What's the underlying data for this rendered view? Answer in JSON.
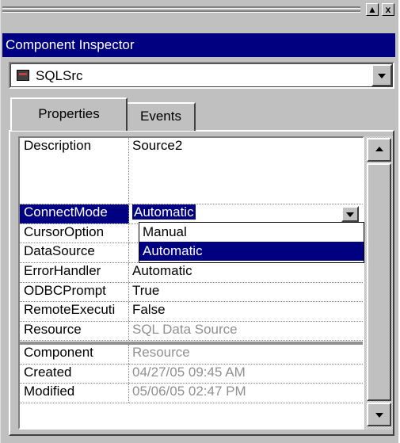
{
  "window": {
    "title": "Component Inspector",
    "restore_glyph": "▲",
    "close_glyph": "x"
  },
  "component_selector": {
    "value": "SQLSrc",
    "icon": "sql-source-icon"
  },
  "tabs": [
    {
      "label": "Properties",
      "active": true
    },
    {
      "label": "Events",
      "active": false
    }
  ],
  "properties": [
    {
      "name": "Description",
      "value": "Source2"
    },
    {
      "name": "ConnectMode",
      "value": "Automatic",
      "selected": true
    },
    {
      "name": "CursorOption",
      "value": ""
    },
    {
      "name": "DataSource",
      "value": ""
    },
    {
      "name": "ErrorHandler",
      "value": "Automatic"
    },
    {
      "name": "ODBCPrompt",
      "value": "True"
    },
    {
      "name": "RemoteExecuti",
      "value": "False"
    },
    {
      "name": "Resource",
      "value": "SQL Data Source",
      "readonly": true
    }
  ],
  "info": [
    {
      "name": "Component",
      "value": "Resource"
    },
    {
      "name": "Created",
      "value": "04/27/05 09:45 AM"
    },
    {
      "name": "Modified",
      "value": "05/06/05 02:47 PM"
    }
  ],
  "dropdown_options": [
    {
      "label": "Manual",
      "highlighted": false
    },
    {
      "label": "Automatic",
      "highlighted": true
    }
  ],
  "colors": {
    "title_bar": "#000080",
    "selection": "#000080",
    "face": "#c0c0c0",
    "readonly_text": "#909090"
  }
}
